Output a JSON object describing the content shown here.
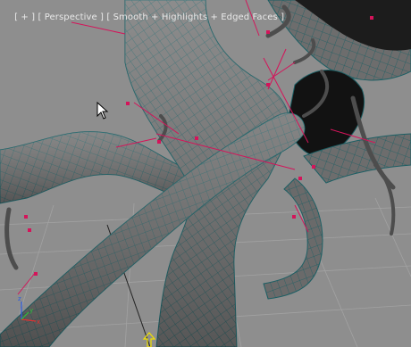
{
  "viewport": {
    "label": {
      "menu": "[ + ]",
      "view": "[ Perspective ]",
      "shading": "[ Smooth + Highlights + Edged Faces ]"
    },
    "axes": {
      "x": "x",
      "y": "y",
      "z": "z"
    },
    "colors": {
      "background": "#8e8e8e",
      "mesh_fill": "#6f6f6f",
      "mesh_wire": "#1a5a5f",
      "grid": "#9c9c9c",
      "bone_lines": "#d4145a",
      "selection": "#d4145a"
    },
    "icons": [
      "mouse-cursor-icon",
      "axis-gizmo-icon",
      "pivot-gizmo-icon"
    ]
  }
}
